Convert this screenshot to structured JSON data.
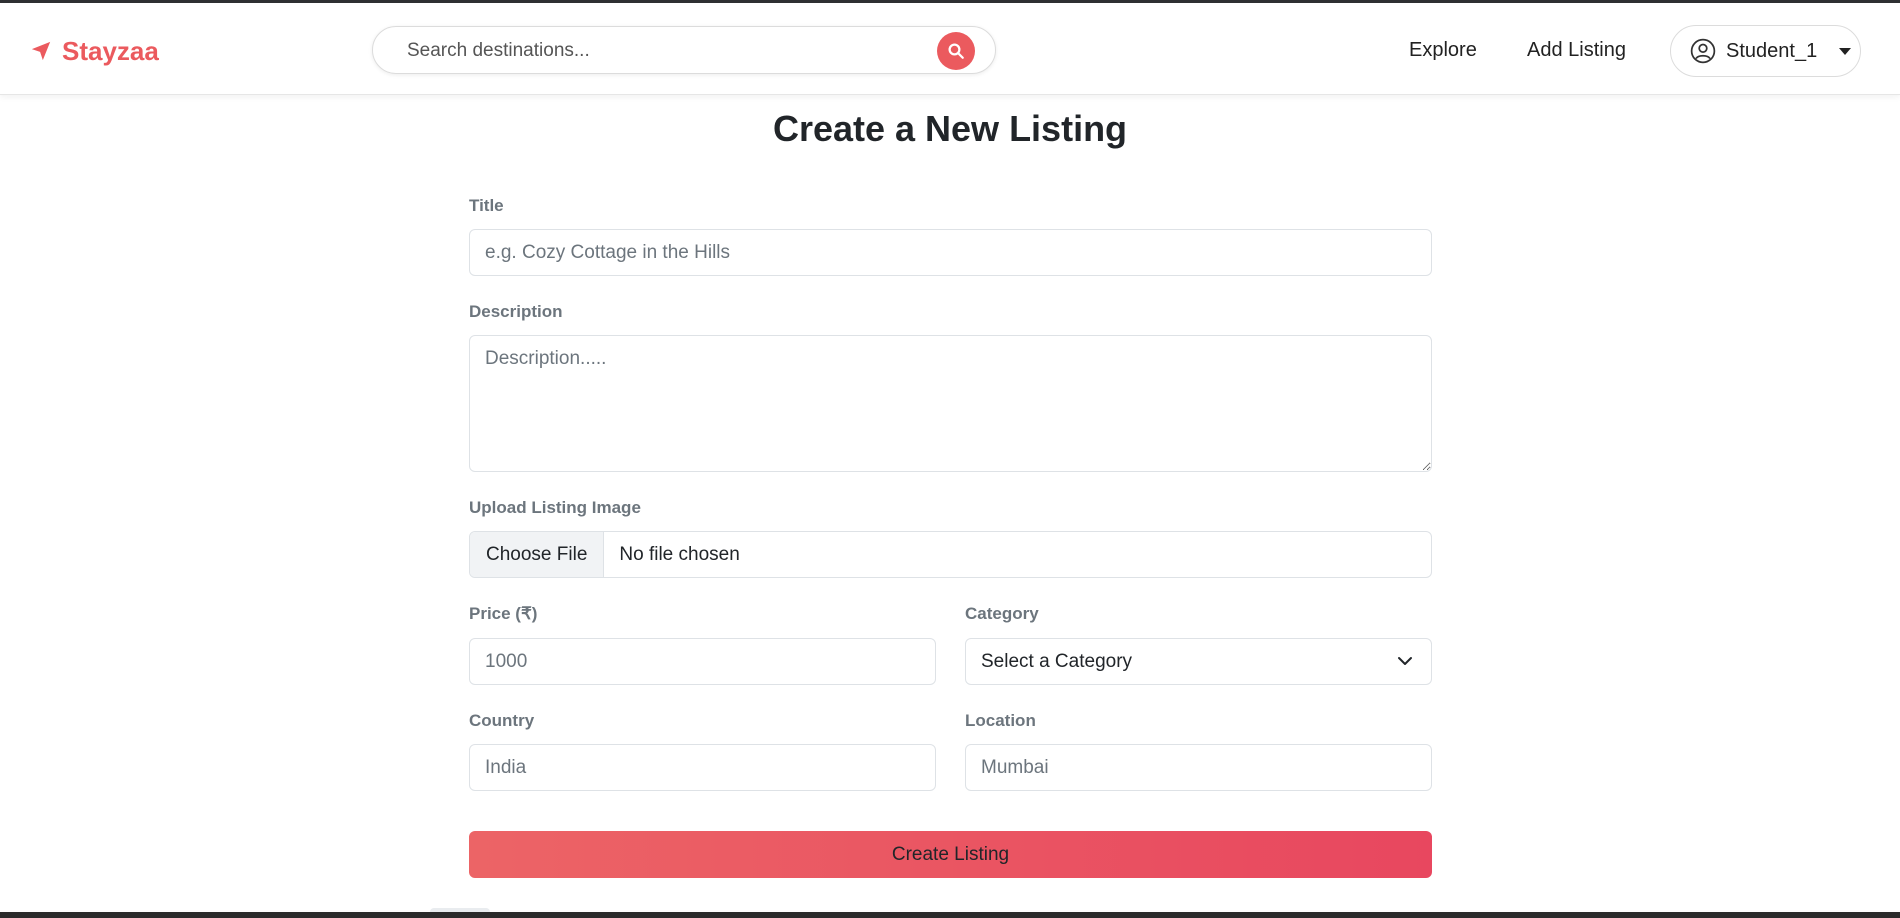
{
  "brand": {
    "name": "Stayzaa"
  },
  "search": {
    "placeholder": "Search destinations..."
  },
  "nav": {
    "explore": "Explore",
    "add_listing": "Add Listing"
  },
  "user": {
    "name": "Student_1"
  },
  "form": {
    "title": "Create a New Listing",
    "title_label": "Title",
    "title_placeholder": "e.g. Cozy Cottage in the Hills",
    "description_label": "Description",
    "description_placeholder": "Description.....",
    "image_label": "Upload Listing Image",
    "choose_file": "Choose File",
    "no_file": "No file chosen",
    "price_label": "Price (₹)",
    "price_placeholder": "1000",
    "category_label": "Category",
    "category_selected": "Select a Category",
    "country_label": "Country",
    "country_placeholder": "India",
    "location_label": "Location",
    "location_placeholder": "Mumbai",
    "submit": "Create Listing"
  },
  "colors": {
    "brand": "#eb5a5e",
    "button_start": "#ec6466",
    "button_end": "#e8475f"
  }
}
